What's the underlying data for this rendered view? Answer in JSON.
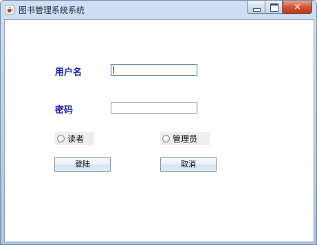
{
  "window": {
    "title": "图书管理系统系统",
    "buttons": {
      "minimize": "minimize",
      "maximize": "maximize",
      "close": "✕"
    }
  },
  "form": {
    "username_label": "用户名",
    "username_value": "",
    "password_label": "密码",
    "password_value": "",
    "roles": [
      {
        "label": "读者",
        "selected": false
      },
      {
        "label": "管理员",
        "selected": false
      }
    ],
    "login_button": "登陆",
    "cancel_button": "取消"
  },
  "colors": {
    "label_blue": "#1a1aa6",
    "radio_bg": "#eeeeee",
    "close_red": "#c4371b"
  },
  "icons": [
    "java-cup-icon",
    "minimize-icon",
    "maximize-icon",
    "close-icon",
    "radio-icon"
  ]
}
